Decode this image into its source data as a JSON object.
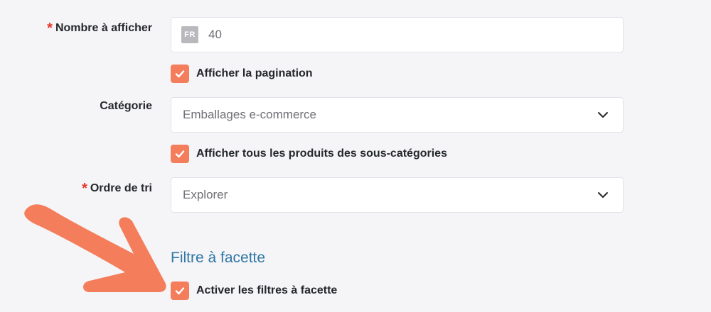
{
  "form": {
    "count": {
      "required_mark": "*",
      "label": "Nombre à afficher",
      "lang_badge": "FR",
      "value": "40"
    },
    "pagination_checkbox": {
      "label": "Afficher la pagination",
      "checked": true
    },
    "category": {
      "label": "Catégorie",
      "value": "Emballages e-commerce"
    },
    "subcategories_checkbox": {
      "label": "Afficher tous les produits des sous-catégories",
      "checked": true
    },
    "sort_order": {
      "required_mark": "*",
      "label": "Ordre de tri",
      "value": "Explorer"
    }
  },
  "facet_section": {
    "title": "Filtre à facette",
    "enable_checkbox": {
      "label": "Activer les filtres à facette",
      "checked": true
    }
  },
  "colors": {
    "accent": "#f47d5b",
    "required": "#e8372a",
    "section_title": "#2f77a4",
    "background": "#f5f4f7"
  },
  "icons": {
    "checkbox": "check-icon",
    "select": "chevron-down-icon",
    "annotation": "arrow-annotation"
  }
}
